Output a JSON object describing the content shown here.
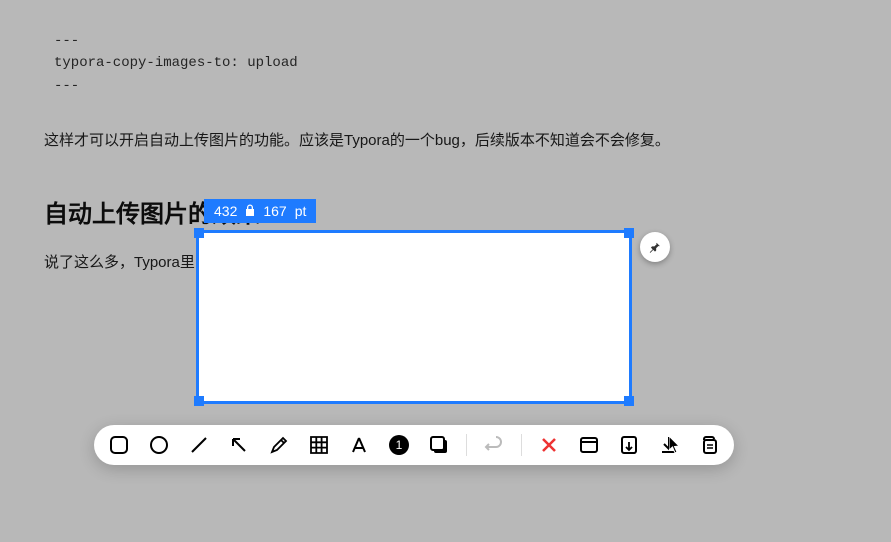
{
  "document": {
    "codeblock": {
      "line1": "---",
      "line2": "typora-copy-images-to: upload",
      "line3": "---"
    },
    "paragraph1": "这样才可以开启自动上传图片的功能。应该是Typora的一个bug，后续版本不知道会不会修复。",
    "heading": "自动上传图片的效果",
    "paragraph2": "说了这么多，Typora里引入图片即上传的效果是怎么样的呢？我录制了一个gif："
  },
  "screenshot": {
    "dimensions": {
      "width": "432",
      "height": "167",
      "unit": "pt"
    }
  },
  "toolbar": {
    "counter": "1"
  }
}
